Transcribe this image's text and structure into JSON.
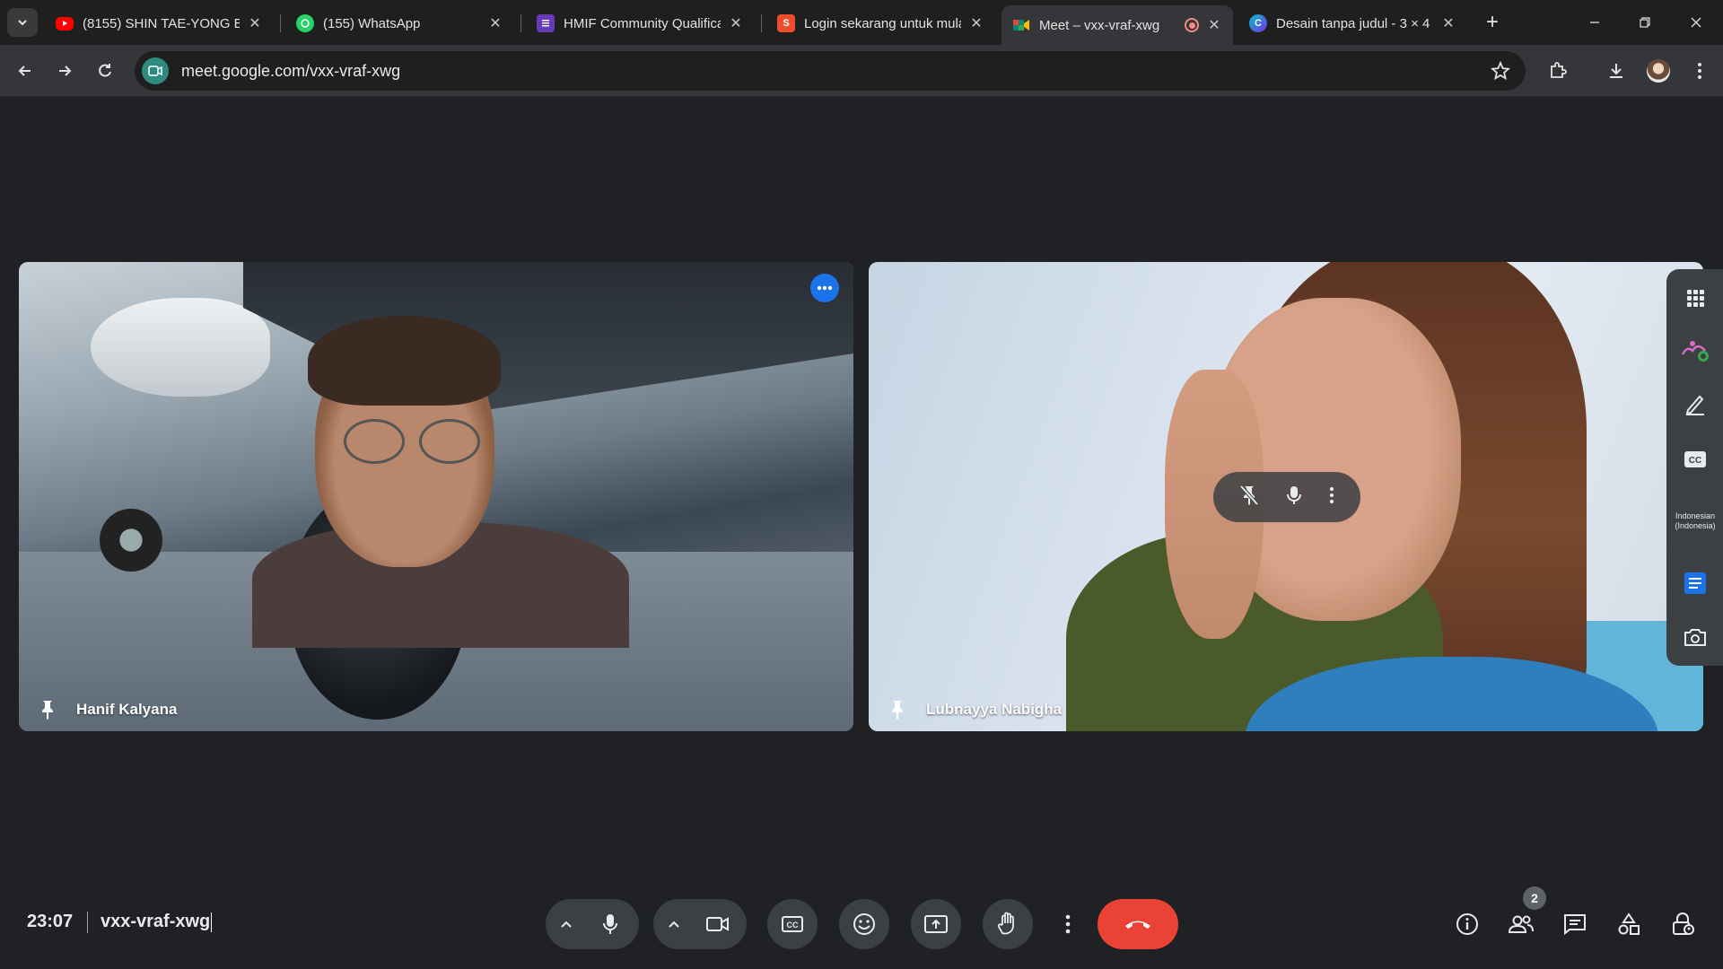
{
  "browser": {
    "tabs": [
      {
        "title": "(8155) SHIN TAE-YONG BE",
        "favicon": "youtube-icon",
        "color": "#ff0000"
      },
      {
        "title": "(155) WhatsApp",
        "favicon": "whatsapp-icon",
        "color": "#25d366"
      },
      {
        "title": "HMIF Community Qualifica",
        "favicon": "forms-icon",
        "color": "#673ab7"
      },
      {
        "title": "Login sekarang untuk mula",
        "favicon": "shop-icon",
        "color": "#ee4d2d"
      },
      {
        "title": "Meet – vxx-vraf-xwg",
        "favicon": "meet-icon",
        "color": "#00897b",
        "active": true,
        "recording": true
      },
      {
        "title": "Desain tanpa judul - 3 × 4",
        "favicon": "canva-icon",
        "color": "#00c4cc"
      }
    ],
    "url": "meet.google.com/vxx-vraf-xwg"
  },
  "meeting": {
    "participants": [
      {
        "name": "Hanif Kalyana"
      },
      {
        "name": "Lubnayya Nabigha"
      }
    ],
    "side_panel": {
      "language": "Indonesian (Indonesia)"
    },
    "time": "23:07",
    "code": "vxx-vraf-xwg",
    "participant_count": "2"
  },
  "colors": {
    "background": "#202124",
    "control_bg": "#3c4043",
    "end_call": "#ea4335",
    "accent": "#1a73e8"
  }
}
